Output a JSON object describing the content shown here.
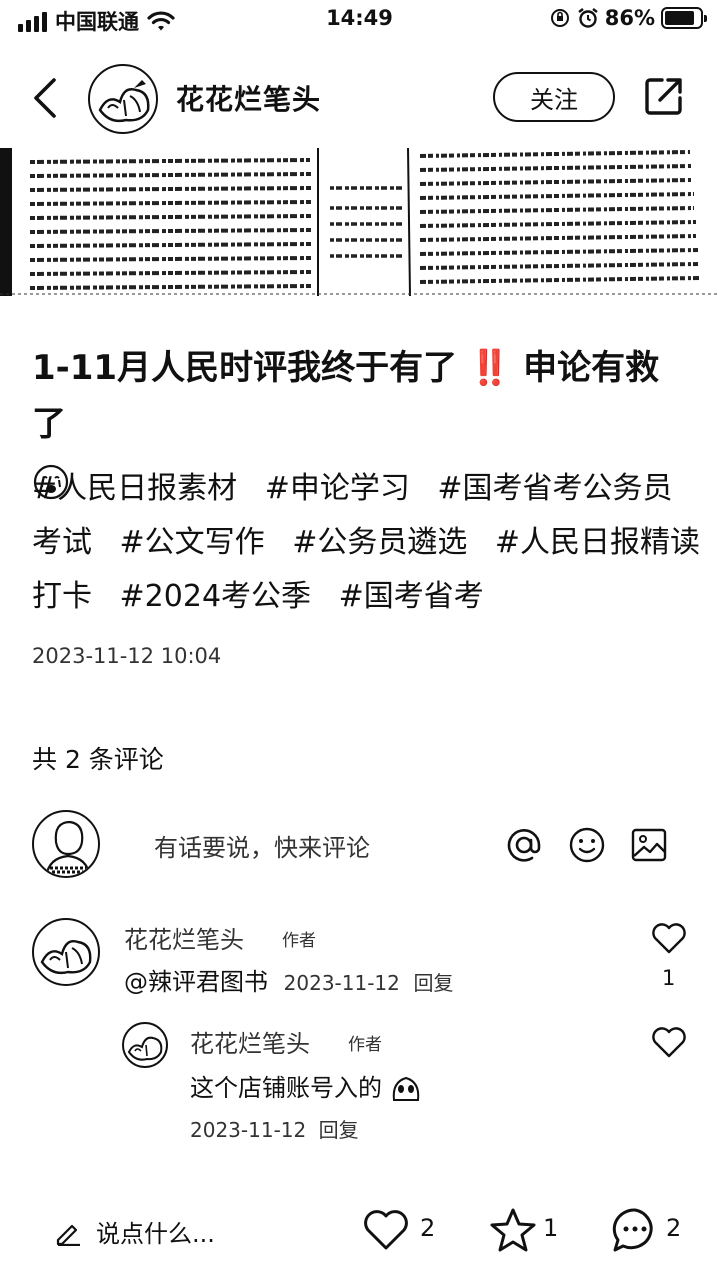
{
  "status_bar": {
    "carrier": "中国联通",
    "time": "14:49",
    "battery_pct": "86%",
    "battery_level": 0.86,
    "icons": [
      "signal-icon",
      "wifi-icon",
      "orientation-lock-icon",
      "alarm-icon",
      "battery-icon"
    ]
  },
  "nav": {
    "author_name": "花花烂笔头",
    "follow_label": "关注",
    "icons": [
      "back-icon",
      "share-icon"
    ]
  },
  "post": {
    "title": "1-11月人民时评我终于有了 ‼️ 申论有救了",
    "title_emoji": "crying-face-emoji",
    "tags": [
      "#人民日报素材",
      "#申论学习",
      "#国考省考公务员考试",
      "#公文写作",
      "#公务员遴选",
      "#人民日报精读打卡",
      "#2024考公季",
      "#国考省考"
    ],
    "time": "2023-11-12 10:04"
  },
  "comments_section": {
    "count_label": "共 2 条评论",
    "input_placeholder": "有话要说，快来评论",
    "icons": [
      "at-icon",
      "emoji-icon",
      "image-icon"
    ]
  },
  "comments": [
    {
      "name": "花花烂笔头",
      "tag": "作者",
      "text": "@辣评君图书",
      "date": "2023-11-12",
      "reply": "回复",
      "likes": "1"
    },
    {
      "name": "花花烂笔头",
      "tag": "作者",
      "text": "这个店铺账号入的",
      "date": "2023-11-12",
      "reply": "回复",
      "likes": ""
    }
  ],
  "bottom_bar": {
    "say_label": "说点什么...",
    "like_count": "2",
    "collect_count": "1",
    "comment_count": "2"
  }
}
